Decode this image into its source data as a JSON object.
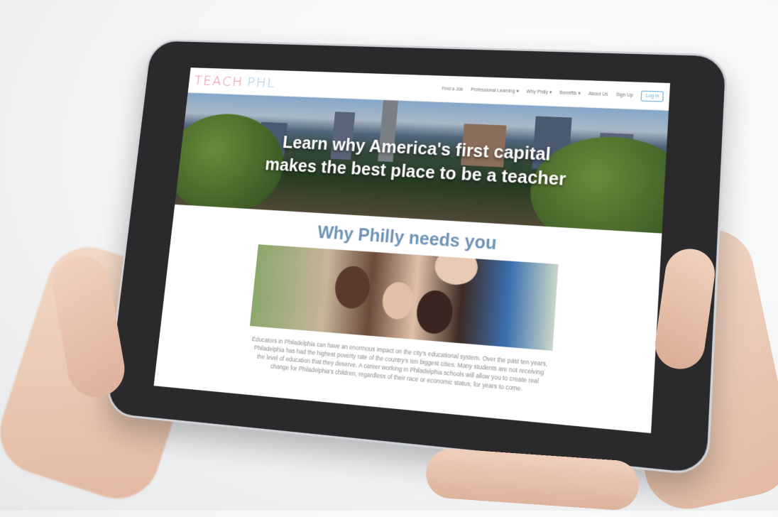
{
  "brand": {
    "logo_teach": "TEACH",
    "logo_phl": "PHL"
  },
  "nav": {
    "items": [
      "Find a Job",
      "Professional Learning ▾",
      "Why Philly ▾",
      "Benefits ▾",
      "About Us",
      "Sign Up"
    ],
    "login": "Log in"
  },
  "hero": {
    "headline_line1": "Learn why America's first capital",
    "headline_line2": "makes the best place to be a teacher"
  },
  "section": {
    "title": "Why Philly needs you",
    "body": "Educators in Philadelphia can have an enormous impact on the city's educational system. Over the past ten years, Philadelphia has had the highest poverty rate of the country's ten biggest cities. Many students are not receiving the level of education that they deserve. A career working in Philadelphia schools will allow you to create real change for Philadelphia's children, regardless of their race or economic status, for years to come."
  },
  "colors": {
    "logo_pink": "#e88aa6",
    "logo_blue": "#9cc7e3",
    "heading_blue": "#6f93b8",
    "login_blue": "#5aa8dc"
  }
}
